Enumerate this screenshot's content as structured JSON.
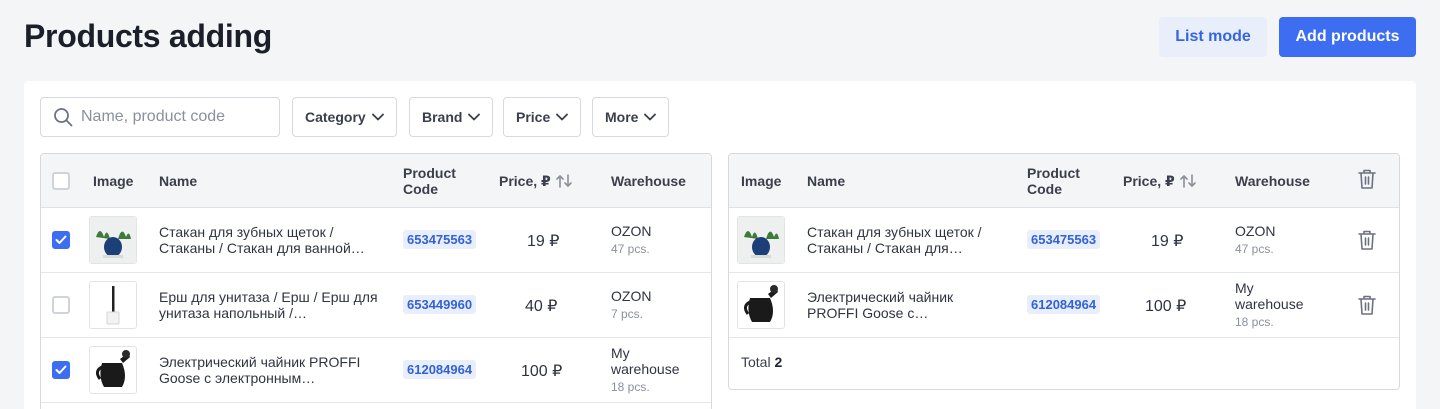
{
  "header": {
    "title": "Products adding",
    "list_mode_label": "List mode",
    "add_products_label": "Add products"
  },
  "filters": {
    "search_placeholder": "Name, product code",
    "category": "Category",
    "brand": "Brand",
    "price": "Price",
    "more": "More"
  },
  "columns": {
    "image": "Image",
    "name": "Name",
    "product_code": "Product Code",
    "price": "Price, ₽",
    "warehouse": "Warehouse"
  },
  "left_rows": [
    {
      "checked": true,
      "name": "Стакан для зубных щеток / Стаканы / Стакан для ванной…",
      "code": "653475563",
      "price": "19 ₽",
      "warehouse": "OZON",
      "qty": "47 pcs.",
      "image": "cup-image"
    },
    {
      "checked": false,
      "name": "Ерш для унитаза / Ерш / Ерш для унитаза напольный /…",
      "code": "653449960",
      "price": "40 ₽",
      "warehouse": "OZON",
      "qty": "7 pcs.",
      "image": "brush-image"
    },
    {
      "checked": true,
      "name": "Электрический чайник PROFFI Goose с электронным…",
      "code": "612084964",
      "price": "100 ₽",
      "warehouse": "My warehouse",
      "qty": "18 pcs.",
      "image": "kettle-image"
    }
  ],
  "right_rows": [
    {
      "name": "Стакан для зубных щеток / Стаканы / Стакан для…",
      "code": "653475563",
      "price": "19 ₽",
      "warehouse": "OZON",
      "qty": "47 pcs.",
      "image": "cup-image"
    },
    {
      "name": "Электрический чайник PROFFI Goose с…",
      "code": "612084964",
      "price": "100 ₽",
      "warehouse": "My warehouse",
      "qty": "18 pcs.",
      "image": "kettle-image"
    }
  ],
  "total": {
    "label": "Total",
    "value": "2"
  },
  "colors": {
    "accent": "#3d6df0",
    "code_bg": "#e8eefc",
    "code_text": "#3262d8"
  }
}
